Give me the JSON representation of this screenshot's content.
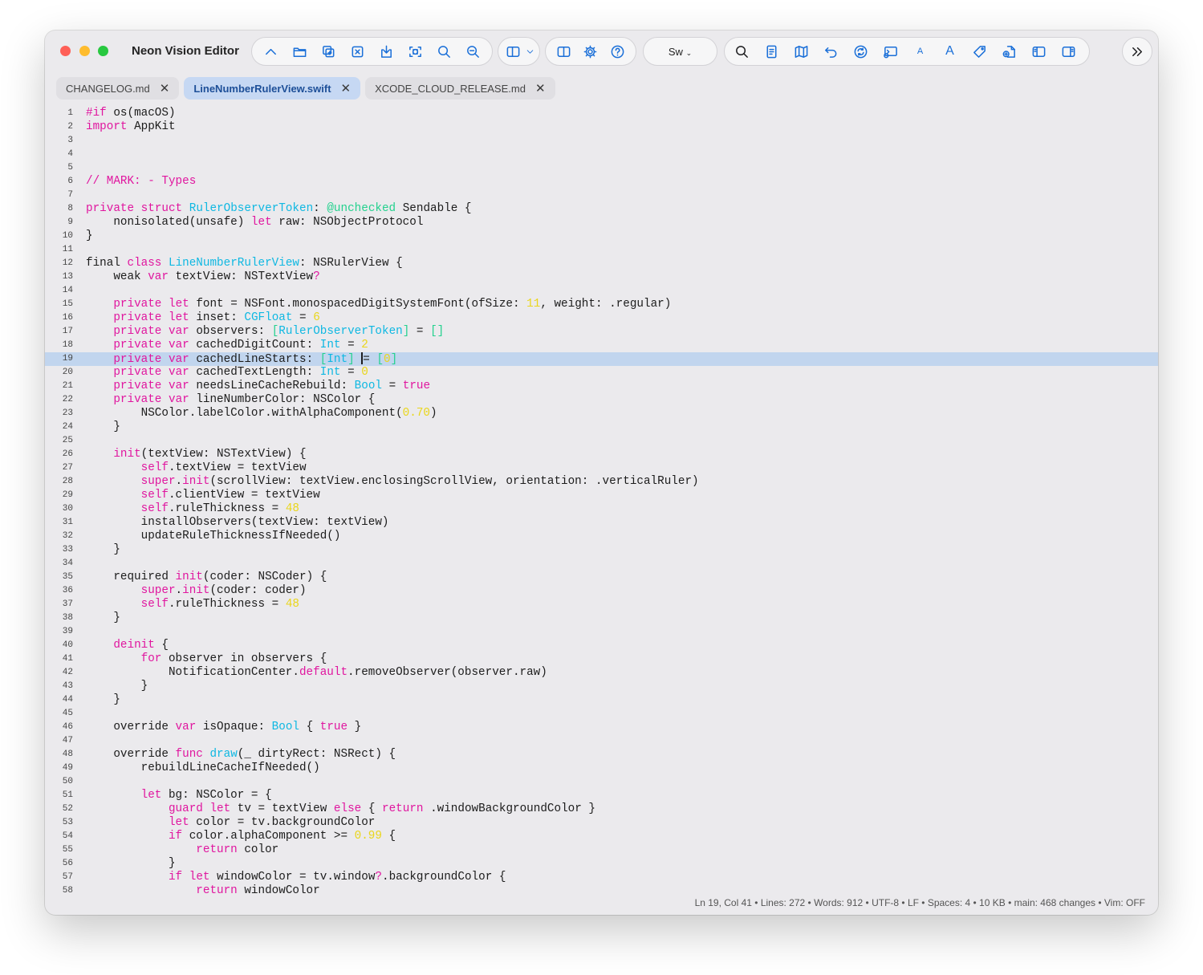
{
  "window": {
    "title": "Neon Vision Editor"
  },
  "toolbar": {
    "language_label": "Sw",
    "left_buttons": [
      "chevron-up-icon",
      "folder-icon",
      "new-tab-icon",
      "close-tab-icon",
      "save-icon",
      "screenshot-icon",
      "search-icon",
      "zoom-out-icon"
    ],
    "layout_buttons": [
      "split-view-icon",
      "chevron-down-icon"
    ],
    "pane_buttons": [
      "sidebar-icon",
      "gear-icon",
      "help-icon"
    ],
    "right_buttons": [
      "search-icon",
      "document-icon",
      "map-icon",
      "undo-icon",
      "sync-icon",
      "terminal-icon",
      "font-small-icon",
      "font-large-icon",
      "tag-icon",
      "file-add-icon",
      "left-panel-icon",
      "right-panel-icon"
    ],
    "overflow_button": "chevron-double-right-icon",
    "font_small_label": "A",
    "font_large_label": "A"
  },
  "tabs": [
    {
      "label": "CHANGELOG.md",
      "active": false
    },
    {
      "label": "LineNumberRulerView.swift",
      "active": true
    },
    {
      "label": "XCODE_CLOUD_RELEASE.md",
      "active": false
    }
  ],
  "editor": {
    "current_line": 19,
    "lines": [
      "#if os(macOS)",
      "import AppKit",
      "",
      "",
      "",
      "// MARK: - Types",
      "",
      "private struct RulerObserverToken: @unchecked Sendable {",
      "    nonisolated(unsafe) let raw: NSObjectProtocol",
      "}",
      "",
      "final class LineNumberRulerView: NSRulerView {",
      "    weak var textView: NSTextView?",
      "",
      "    private let font = NSFont.monospacedDigitSystemFont(ofSize: 11, weight: .regular)",
      "    private let inset: CGFloat = 6",
      "    private var observers: [RulerObserverToken] = []",
      "    private var cachedDigitCount: Int = 2",
      "    private var cachedLineStarts: [Int] = [0]",
      "    private var cachedTextLength: Int = 0",
      "    private var needsLineCacheRebuild: Bool = true",
      "    private var lineNumberColor: NSColor {",
      "        NSColor.labelColor.withAlphaComponent(0.70)",
      "    }",
      "",
      "    init(textView: NSTextView) {",
      "        self.textView = textView",
      "        super.init(scrollView: textView.enclosingScrollView, orientation: .verticalRuler)",
      "        self.clientView = textView",
      "        self.ruleThickness = 48",
      "        installObservers(textView: textView)",
      "        updateRuleThicknessIfNeeded()",
      "    }",
      "",
      "    required init(coder: NSCoder) {",
      "        super.init(coder: coder)",
      "        self.ruleThickness = 48",
      "    }",
      "",
      "    deinit {",
      "        for observer in observers {",
      "            NotificationCenter.default.removeObserver(observer.raw)",
      "        }",
      "    }",
      "",
      "    override var isOpaque: Bool { true }",
      "",
      "    override func draw(_ dirtyRect: NSRect) {",
      "        rebuildLineCacheIfNeeded()",
      "",
      "        let bg: NSColor = {",
      "            guard let tv = textView else { return .windowBackgroundColor }",
      "            let color = tv.backgroundColor",
      "            if color.alphaComponent >= 0.99 {",
      "                return color",
      "            }",
      "            if let windowColor = tv.window?.backgroundColor {",
      "                return windowColor"
    ]
  },
  "status": "Ln 19, Col 41 • Lines: 272 • Words: 912 • UTF-8 • LF • Spaces: 4 • 10 KB • main: 468 changes • Vim: OFF",
  "colors": {
    "keyword": "#e0169f",
    "type": "#0fb8e2",
    "number": "#ead61a",
    "attribute": "#24d18e",
    "current_line": "#c1d5ee",
    "accent": "#1a6fd8"
  }
}
